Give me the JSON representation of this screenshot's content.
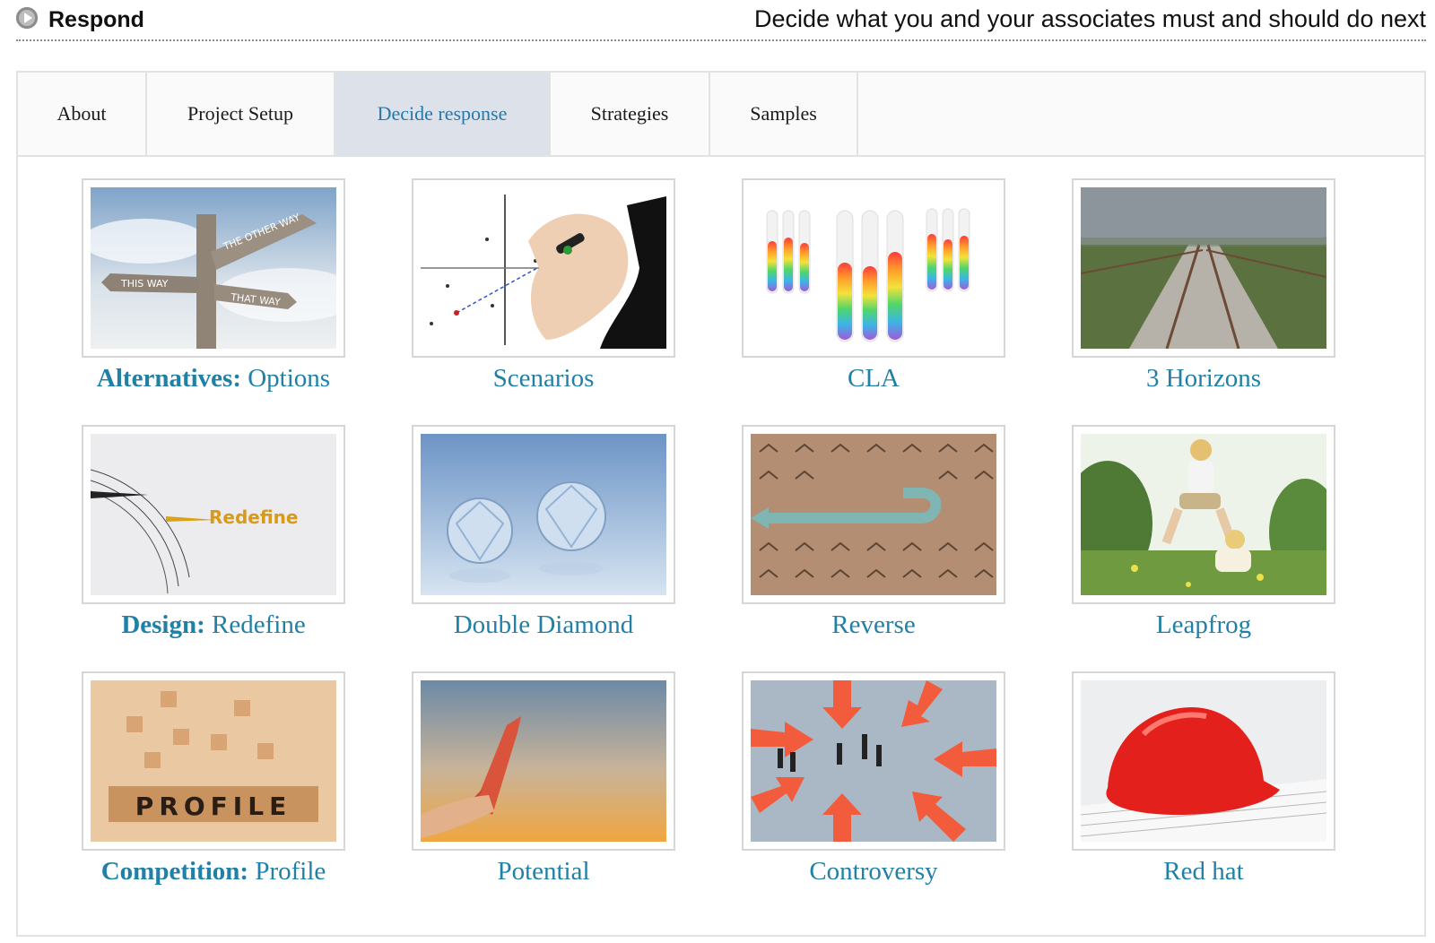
{
  "header": {
    "app_title": "Respond",
    "tagline": "Decide what you and your associates must and should do next"
  },
  "tabs": [
    {
      "label": "About"
    },
    {
      "label": "Project Setup"
    },
    {
      "label": "Decide response",
      "active": true
    },
    {
      "label": "Strategies"
    },
    {
      "label": "Samples"
    }
  ],
  "colors": {
    "accent": "#2180a6",
    "active_tab_bg": "#dde2ea"
  },
  "cards": [
    {
      "group": "Alternatives:",
      "title": "Options",
      "image": "signpost-image",
      "image_text": [
        "THE OTHER WAY",
        "THIS WAY",
        "THAT WAY"
      ]
    },
    {
      "group": "",
      "title": "Scenarios",
      "image": "hand-drawing-graph-image"
    },
    {
      "group": "",
      "title": "CLA",
      "image": "rainbow-test-tubes-image"
    },
    {
      "group": "",
      "title": "3 Horizons",
      "image": "railway-tracks-image"
    },
    {
      "group": "Design:",
      "title": "Redefine",
      "image": "compass-redefine-image",
      "image_text": [
        "Redefine"
      ]
    },
    {
      "group": "",
      "title": "Double Diamond",
      "image": "diamonds-image"
    },
    {
      "group": "",
      "title": "Reverse",
      "image": "reverse-arrows-image"
    },
    {
      "group": "",
      "title": "Leapfrog",
      "image": "children-leapfrog-image"
    },
    {
      "group": "Competition:",
      "title": "Profile",
      "image": "profile-blocks-image",
      "image_text": [
        "PROFILE"
      ]
    },
    {
      "group": "",
      "title": "Potential",
      "image": "rocket-hand-image"
    },
    {
      "group": "",
      "title": "Controversy",
      "image": "arrows-figures-image"
    },
    {
      "group": "",
      "title": "Red hat",
      "image": "red-hardhat-image"
    }
  ]
}
